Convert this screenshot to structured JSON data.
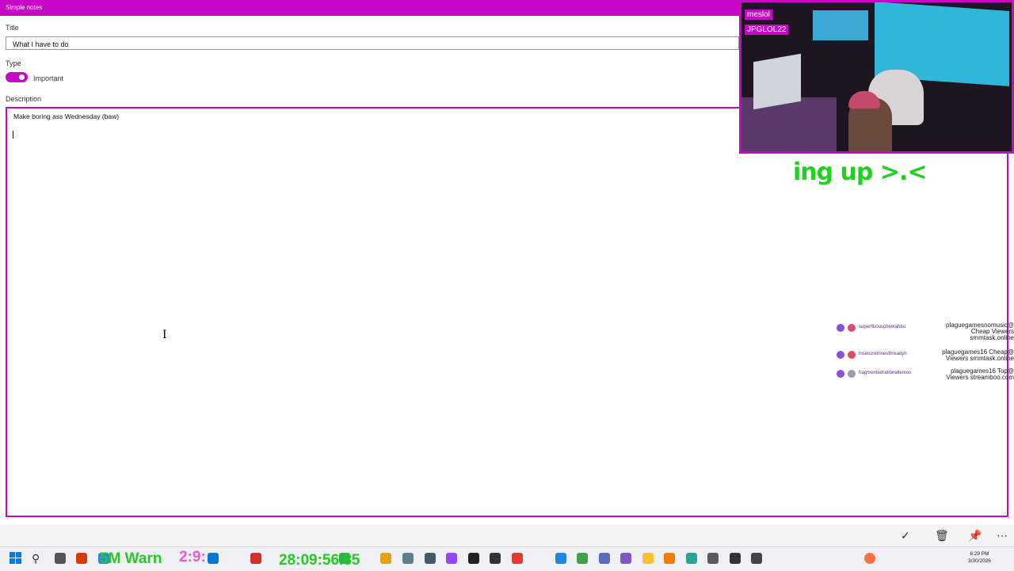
{
  "app": {
    "title": "Simple notes",
    "accent": "#c806c8"
  },
  "form": {
    "title_label": "Title",
    "title_value": "What I have to do",
    "type_label": "Type",
    "toggle_label": "Important",
    "toggle_on": true,
    "description_label": "Description",
    "description_value": "Make boring ass Wednesday (baw)"
  },
  "stream_overlay": {
    "tag_line_1": "meslol",
    "tag_line_2": "JPGLOL22",
    "green_banner": "ing up >.<",
    "chat": [
      {
        "user": "superfluouscheetahbu",
        "message": "plaguegamesnomusic@ Cheap Viewers smmtask.online"
      },
      {
        "user": "lnsecuretrinesthreadyh",
        "message": "plaguegames16 Cheap@ Viewers smmtask.online"
      },
      {
        "user": "fragmentedratlonallemos",
        "message": "plaguegames16 Top@ Viewers streamboo.com"
      }
    ],
    "taskbar_text_1": "5M Warn",
    "taskbar_text_2": "28:09:56.85",
    "taskbar_text_3": "2:9:"
  },
  "command_bar": {
    "icons": [
      "check-icon",
      "trash-icon",
      "pin-icon",
      "more-icon"
    ]
  },
  "taskbar": {
    "time": "6:29 PM",
    "date": "3/30/2026"
  }
}
